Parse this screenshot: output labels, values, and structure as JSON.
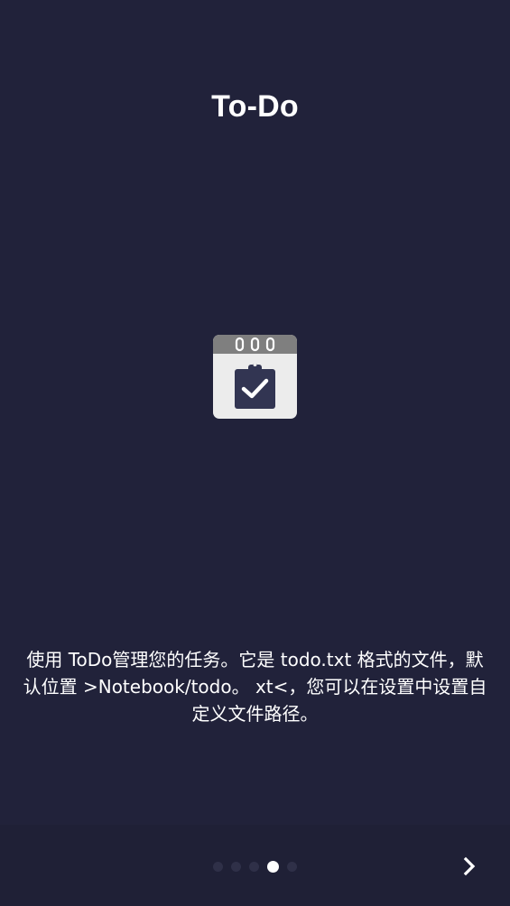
{
  "onboarding": {
    "title": "To-Do",
    "description": "使用 ToDo管理您的任务。它是 todo.txt 格式的文件，默认位置 >Notebook/todo。 xt<，您可以在设置中设置自定义文件路径。",
    "icon": "calendar-checklist-icon",
    "page_indicator": {
      "total": 5,
      "current": 4
    },
    "next_icon": "chevron-right-icon"
  },
  "colors": {
    "background": "#21223a",
    "bottom_bar": "#1f2036",
    "text": "#ffffff",
    "icon_bg": "#ececec",
    "icon_header": "#7f7f7f",
    "icon_clipboard": "#323552",
    "dot_inactive": "#2f3048",
    "dot_active": "#ffffff"
  }
}
